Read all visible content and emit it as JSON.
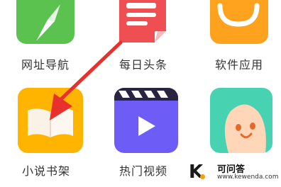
{
  "apps": [
    {
      "label": "网址导航",
      "icon": "compass-icon"
    },
    {
      "label": "每日头条",
      "icon": "newspaper-icon"
    },
    {
      "label": "软件应用",
      "icon": "shopping-bag-icon"
    },
    {
      "label": "小说书架",
      "icon": "open-book-icon"
    },
    {
      "label": "热门视频",
      "icon": "video-play-icon"
    },
    {
      "label": "",
      "icon": "smiling-bean-icon"
    }
  ],
  "watermark": {
    "logo_letter": "K",
    "title": "可问答",
    "domain": "www.kewenda.com"
  },
  "colors": {
    "green": "#5bc24f",
    "red_page": "#ef4e52",
    "orange": "#ffa21d",
    "yellow": "#ffb400",
    "purple": "#6d5cf5",
    "teal": "#47d2b2",
    "arrow": "#e8302c"
  }
}
